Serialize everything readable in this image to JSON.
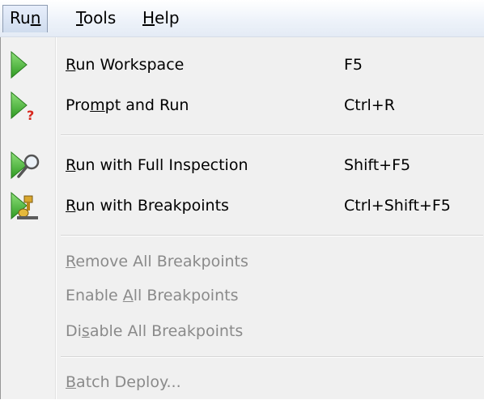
{
  "menubar": {
    "items": [
      {
        "label": "Run"
      },
      {
        "label": "Tools"
      },
      {
        "label": "Help"
      }
    ]
  },
  "menu": {
    "items": [
      {
        "label": "Run Workspace",
        "shortcut": "F5",
        "icon": "run-triangle-icon"
      },
      {
        "label": "Prompt and Run",
        "shortcut": "Ctrl+R",
        "icon": "run-prompt-icon"
      },
      {
        "label": "Run with Full Inspection",
        "shortcut": "Shift+F5",
        "icon": "run-inspect-icon"
      },
      {
        "label": "Run with Breakpoints",
        "shortcut": "Ctrl+Shift+F5",
        "icon": "run-breakpoints-icon"
      },
      {
        "label": "Remove All Breakpoints",
        "disabled": true
      },
      {
        "label": "Enable All Breakpoints",
        "disabled": true
      },
      {
        "label": "Disable All Breakpoints",
        "disabled": true
      },
      {
        "label": "Batch Deploy...",
        "disabled": true
      }
    ]
  },
  "colors": {
    "run_green": "#3aa52c",
    "prompt_red": "#d8281e",
    "disabled_text": "#8a8a8a"
  }
}
